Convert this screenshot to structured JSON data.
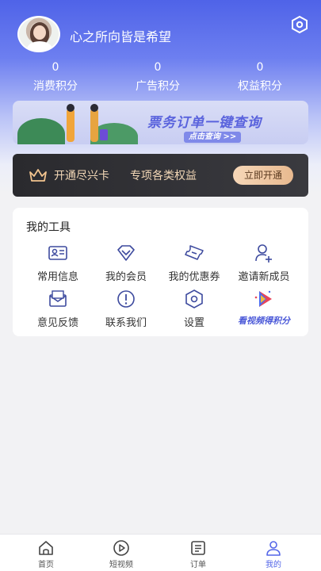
{
  "profile": {
    "username": "心之所向皆是希望"
  },
  "stats": [
    {
      "value": "0",
      "label": "消费积分"
    },
    {
      "value": "0",
      "label": "广告积分"
    },
    {
      "value": "0",
      "label": "权益积分"
    }
  ],
  "ticket_banner": {
    "title": "票务订单一键查询",
    "cta": "点击查询 >>"
  },
  "vip_banner": {
    "title": "开通尽兴卡",
    "subtitle": "专项各类权益",
    "button": "立即开通"
  },
  "tools": {
    "title": "我的工具",
    "items": [
      {
        "label": "常用信息",
        "icon": "id-card-icon"
      },
      {
        "label": "我的会员",
        "icon": "diamond-icon"
      },
      {
        "label": "我的优惠券",
        "icon": "coupon-icon"
      },
      {
        "label": "邀请新成员",
        "icon": "add-user-icon"
      },
      {
        "label": "意见反馈",
        "icon": "mail-icon"
      },
      {
        "label": "联系我们",
        "icon": "info-icon"
      },
      {
        "label": "设置",
        "icon": "settings-icon"
      },
      {
        "label": "看视频得积分",
        "icon": "video-play-icon"
      }
    ]
  },
  "tabbar": {
    "items": [
      {
        "label": "首页",
        "icon": "home-icon"
      },
      {
        "label": "短视频",
        "icon": "play-icon"
      },
      {
        "label": "订单",
        "icon": "order-icon"
      },
      {
        "label": "我的",
        "icon": "user-icon"
      }
    ],
    "active": "我的"
  },
  "colors": {
    "primary": "#5466e8",
    "vip_gold": "#f2d7b6",
    "background": "#f2f2f4"
  }
}
